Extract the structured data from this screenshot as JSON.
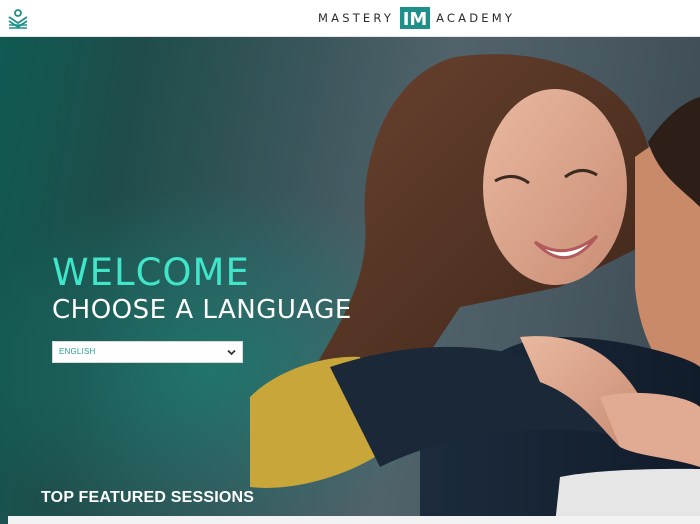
{
  "header": {
    "brand_left": "MASTERY",
    "brand_mark": "IM",
    "brand_right": "ACADEMY",
    "menu_icon": "lotus-logo-icon"
  },
  "hero": {
    "welcome": "WELCOME",
    "subtitle": "CHOOSE A LANGUAGE",
    "language_select": {
      "value": "ENGLISH",
      "icon": "chevron-down-icon"
    }
  },
  "sections": {
    "featured_title": "TOP FEATURED SESSIONS"
  },
  "colors": {
    "accent": "#3fe6c9",
    "brand_teal": "#1f8f8a",
    "header_bg": "#ffffff"
  }
}
